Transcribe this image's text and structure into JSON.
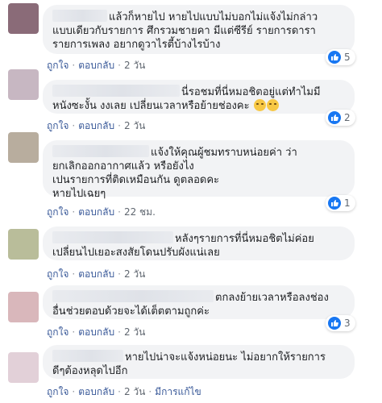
{
  "actions": {
    "like": "ถูกใจ",
    "reply": "ตอบกลับ",
    "translate": "มีการแก้ไข"
  },
  "comments": [
    {
      "line1": "แล้วก็หายไป หายไปแบบไม่บอกไม่แจ้งไม่กล่าว",
      "rest": "แบบเดียวกับรายการ ศึกรวมชายคา มีแต่ซีรีย์ รายการดารา\nรายการเพลง อยากดูวาไรตี้บ้างไรบ้าง",
      "time": "2 วัน",
      "likes": "5",
      "avatar_color": "#8a6b78"
    },
    {
      "line1": "นี่รอชมที่นี่หมอชิตอยู่แต่ทำไมมี",
      "rest": "หนังซะงั้น งงเลย เปลี่ยนเวลาหรือย้ายช่องคะ",
      "emoji": "thinking-emoji",
      "time": "2 วัน",
      "likes": "2",
      "avatar_color": "#c7b7c2"
    },
    {
      "line1": "แจ้งให้คุณผู้ชมทราบหน่อยค่า ว่า",
      "rest": "ยกเลิกออกอากาศแล้ว หรือยังไง\nเปนรายการที่ติดเหมือนกัน ดูตลอดคะ\nหายไปเฉยๆ",
      "time": "22 ชม.",
      "likes": "1",
      "avatar_color": "#b8ad9e"
    },
    {
      "line1": "หลังๆรายการที่นี่หมอชิตไม่ค่อย",
      "rest": "เปลี่ยนไปเยอะสงสัยโดนปรับผังแน่เลย",
      "time": "2 วัน",
      "likes": "",
      "avatar_color": "#b9bd9a"
    },
    {
      "line1": "ตกลงย้ายเวลาหรือลงช่อง",
      "rest": "อื่นช่วยตอบด้วยจะได้เต็ตตามถูกค่ะ",
      "time": "2 วัน",
      "likes": "3",
      "avatar_color": "#d9b7bb"
    },
    {
      "line1": "หายไปน่าจะแจ้งหน่อยนะ ไม่อยากให้รายการ",
      "rest": "ดีๆต้องหลุดไปอีก",
      "time": "2 วัน",
      "likes": "",
      "edited": true,
      "avatar_color": "#e2d0d8"
    }
  ]
}
